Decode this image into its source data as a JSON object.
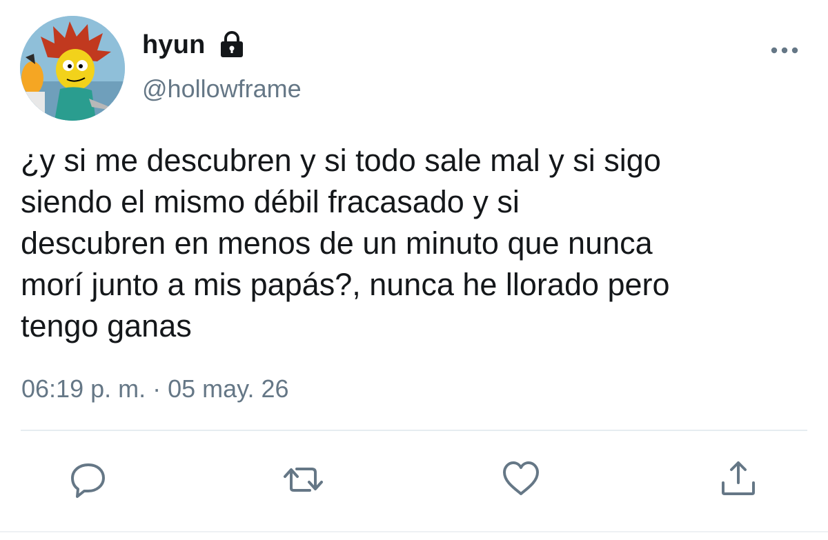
{
  "user": {
    "display_name": "hyun",
    "handle": "@hollowframe",
    "protected": true
  },
  "tweet": {
    "text": "¿y si me descubren y si todo sale mal y si sigo\nsiendo el mismo débil fracasado y si\ndescubren en menos de un minuto que nunca\nmorí junto a mis papás?, nunca he llorado pero\ntengo ganas",
    "timestamp": "06:19 p. m. · 05 may. 26"
  },
  "actions": [
    {
      "name": "reply",
      "icon": "speech-bubble-icon"
    },
    {
      "name": "retweet",
      "icon": "retweet-arrows-icon"
    },
    {
      "name": "like",
      "icon": "heart-icon"
    },
    {
      "name": "share",
      "icon": "share-upload-icon"
    }
  ],
  "colors": {
    "text_primary": "#14171a",
    "text_secondary": "#657786",
    "icon": "#657786",
    "divider": "#e6ecf0"
  }
}
